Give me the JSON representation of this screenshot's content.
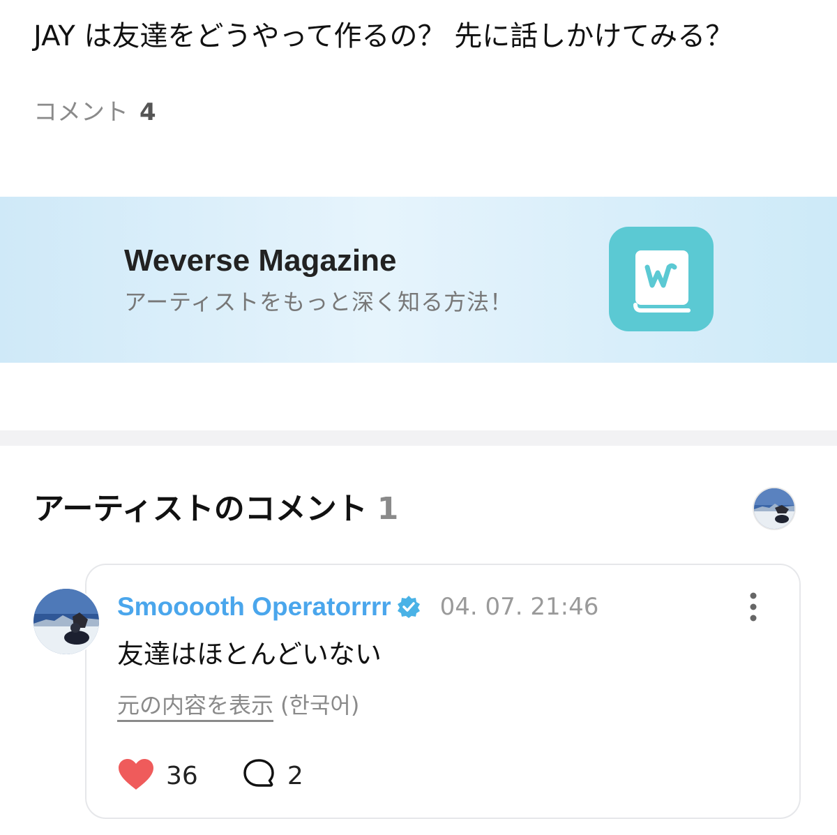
{
  "post": {
    "text": "JAY は友達をどうやって作るの？ 先に話しかけてみる？",
    "comments_label": "コメント",
    "comments_count": "4"
  },
  "banner": {
    "title": "Weverse Magazine",
    "subtitle": "アーティストをもっと深く知る方法！",
    "icon": "weverse-magazine-book-icon",
    "accent_color": "#5bc9d3"
  },
  "artist_comments": {
    "heading": "アーティストのコメント",
    "count": "1",
    "comment": {
      "author": "Smooooth Operatorrrr",
      "verified": true,
      "timestamp": "04. 07. 21:46",
      "body": "友達はほとんどいない",
      "show_original_label": "元の内容を表示",
      "original_language": "(한국어)",
      "likes": "36",
      "replies": "2",
      "like_color": "#ef5b5b",
      "author_color": "#4aa6ec"
    }
  }
}
